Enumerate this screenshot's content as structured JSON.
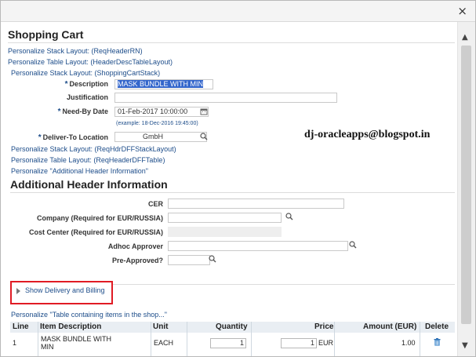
{
  "dialog": {
    "close_glyph": "×"
  },
  "shopping_cart": {
    "title": "Shopping Cart",
    "personalize_links": [
      "Personalize Stack Layout: (ReqHeaderRN)",
      "Personalize Table Layout: (HeaderDescTableLayout)",
      "Personalize Stack Layout: (ShoppingCartStack)"
    ],
    "fields": {
      "description": {
        "label": "Description",
        "required": true,
        "value": "MASK BUNDLE WITH MIN"
      },
      "justification": {
        "label": "Justification",
        "value": ""
      },
      "need_by_date": {
        "label": "Need-By Date",
        "required": true,
        "value": "01-Feb-2017 10:00:00",
        "hint": "(example: 18-Dec-2016 19:45:00)",
        "icon": "calendar-icon"
      },
      "deliver_to": {
        "label": "Deliver-To Location",
        "required": true,
        "value": "GmbH",
        "icon": "search-icon"
      }
    },
    "required_mark": "*",
    "personalize_links_2": [
      "Personalize Stack Layout: (ReqHdrDFFStackLayout)",
      "Personalize Table Layout: (ReqHeaderDFFTable)",
      "Personalize \"Additional Header Information\""
    ]
  },
  "watermark": "dj-oracleapps@blogspot.in",
  "additional_header": {
    "title": "Additional Header Information",
    "fields": [
      {
        "label": "CER",
        "value": ""
      },
      {
        "label": "Company (Required for EUR/RUSSIA)",
        "value": ""
      },
      {
        "label": "Cost Center (Required for EUR/RUSSIA)",
        "value": ""
      },
      {
        "label": "Adhoc Approver",
        "value": ""
      },
      {
        "label": "Pre-Approved?",
        "value": ""
      }
    ]
  },
  "delivery_billing": {
    "label": "Show Delivery and Billing",
    "expanded": false
  },
  "items_table": {
    "personalize_link": "Personalize \"Table containing items in the shop...\"",
    "columns": [
      "Line",
      "Item Description",
      "Unit",
      "Quantity",
      "Price",
      "Amount (EUR)",
      "Delete"
    ],
    "rows": [
      {
        "line": "1",
        "item_line1": "MASK BUNDLE WITH",
        "item_line2": "MIN",
        "unit": "EACH",
        "quantity": "1",
        "price": "1",
        "currency": "EUR",
        "amount": "1.00",
        "delete_icon": "trash-icon"
      }
    ]
  },
  "colors": {
    "link": "#1d4d8a",
    "highlight": "#3366cc",
    "callout_border": "#e01b24",
    "header_bg": "#e9eef3"
  }
}
